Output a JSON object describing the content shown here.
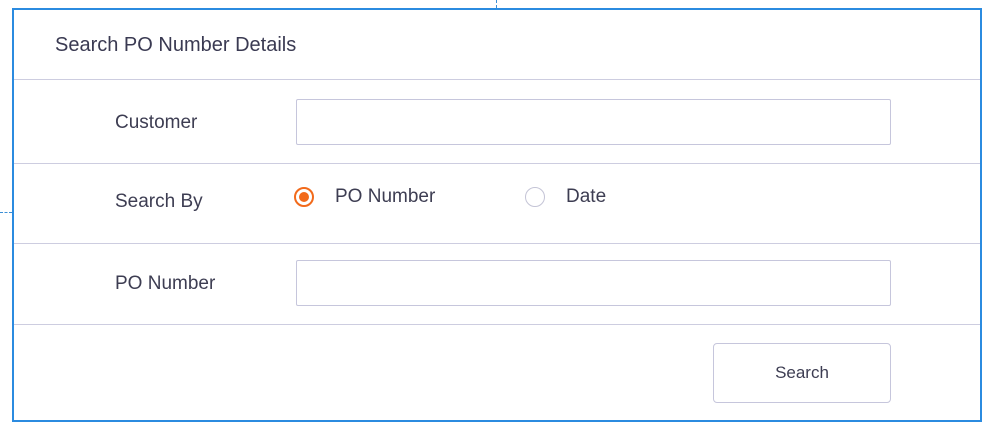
{
  "panel": {
    "title": "Search PO Number Details"
  },
  "form": {
    "customer": {
      "label": "Customer",
      "value": "",
      "placeholder": ""
    },
    "search_by": {
      "label": "Search By",
      "selected": "PO Number",
      "options": [
        {
          "label": "PO Number",
          "checked": true
        },
        {
          "label": "Date",
          "checked": false
        }
      ]
    },
    "po_number": {
      "label": "PO Number",
      "value": "",
      "placeholder": ""
    }
  },
  "actions": {
    "search_label": "Search"
  },
  "colors": {
    "accent": "#f26a1b",
    "panel_border": "#2b8be0",
    "divider": "#cdcde0"
  }
}
